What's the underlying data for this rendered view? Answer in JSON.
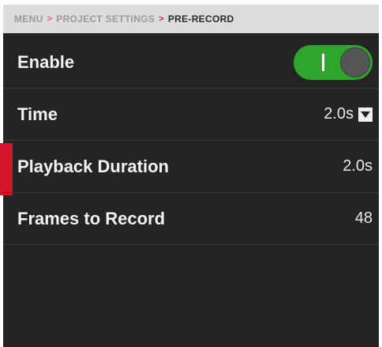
{
  "breadcrumb": {
    "items": [
      "MENU",
      "PROJECT SETTINGS",
      "PRE-RECORD"
    ],
    "separator": ">"
  },
  "settings": {
    "enable": {
      "label": "Enable",
      "toggle_on": true
    },
    "time": {
      "label": "Time",
      "value": "2.0s"
    },
    "playback": {
      "label": "Playback Duration",
      "value": "2.0s"
    },
    "frames": {
      "label": "Frames to Record",
      "value": "48"
    }
  },
  "colors": {
    "accent_selected": "#d4142a",
    "toggle_on": "#2fa52c",
    "background": "#242424",
    "breadcrumb_bg": "#dcdcdc"
  },
  "icons": {
    "toggle": "toggle-switch-icon",
    "dropdown": "chevron-down-icon"
  }
}
